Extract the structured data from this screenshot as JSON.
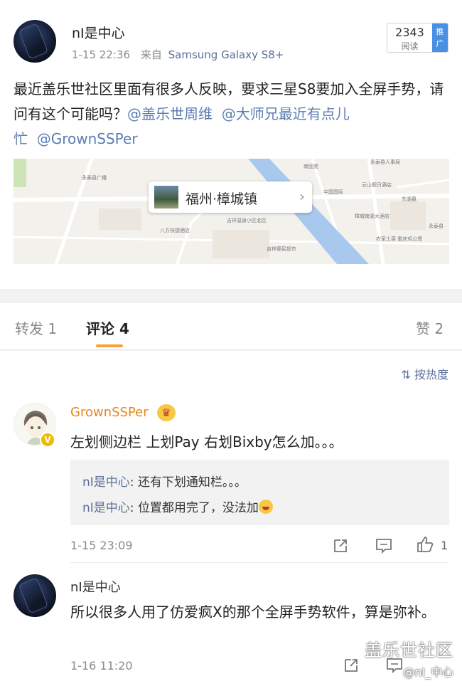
{
  "post": {
    "author": "nI是中心",
    "time": "1-15 22:36",
    "source_prefix": "来自",
    "device": "Samsung Galaxy S8+",
    "read_count": "2343",
    "read_label": "阅读",
    "promo_label": "推广",
    "text_main": "最近盖乐世社区里面有很多人反映，要求三星S8要加入全屏手势，请问有这个可能吗？",
    "mention_1": "@盖乐世周维",
    "mention_2": "@大师兄最近有点儿忙",
    "mention_3": "@GrownSSPer",
    "location": "福州·樟城镇",
    "map_labels": {
      "l1": "永泰县广播",
      "l2": "南固苑",
      "l3": "永泰县人事局",
      "l4": "云山假日酒店",
      "l5": "中国国际",
      "l6": "樟城南湖大酒店",
      "l7": "吉祥温泉小区北区",
      "l8": "八方快捷酒店",
      "l9": "吉祥便民超市",
      "l10": "农家土菜·重庆鸡公煲",
      "l11": "永泰县",
      "l12": "东湖墓"
    }
  },
  "tabs": {
    "repost": "转发 1",
    "comments": "评论 4",
    "likes": "赞 2"
  },
  "sort_label": "按热度",
  "comments": [
    {
      "author": "GrownSSPer",
      "text": "左划侧边栏 上划Pay 右划Bixby怎么加。。。",
      "replies": [
        {
          "name": "nI是中心",
          "text": "还有下划通知栏。。。"
        },
        {
          "name": "nI是中心",
          "text": "位置都用完了，没法加"
        }
      ],
      "time": "1-15 23:09",
      "likes": "1"
    },
    {
      "author": "nI是中心",
      "text": "所以很多人用了仿爱疯X的那个全屏手势软件，算是弥补。",
      "time": "1-16 11:20"
    }
  ],
  "watermark": {
    "line1": "盖乐世社区",
    "line2": "@nI_中心"
  },
  "colors": {
    "link": "#5b7db1",
    "accent": "#f7a23a",
    "vip_name": "#e8861e"
  }
}
